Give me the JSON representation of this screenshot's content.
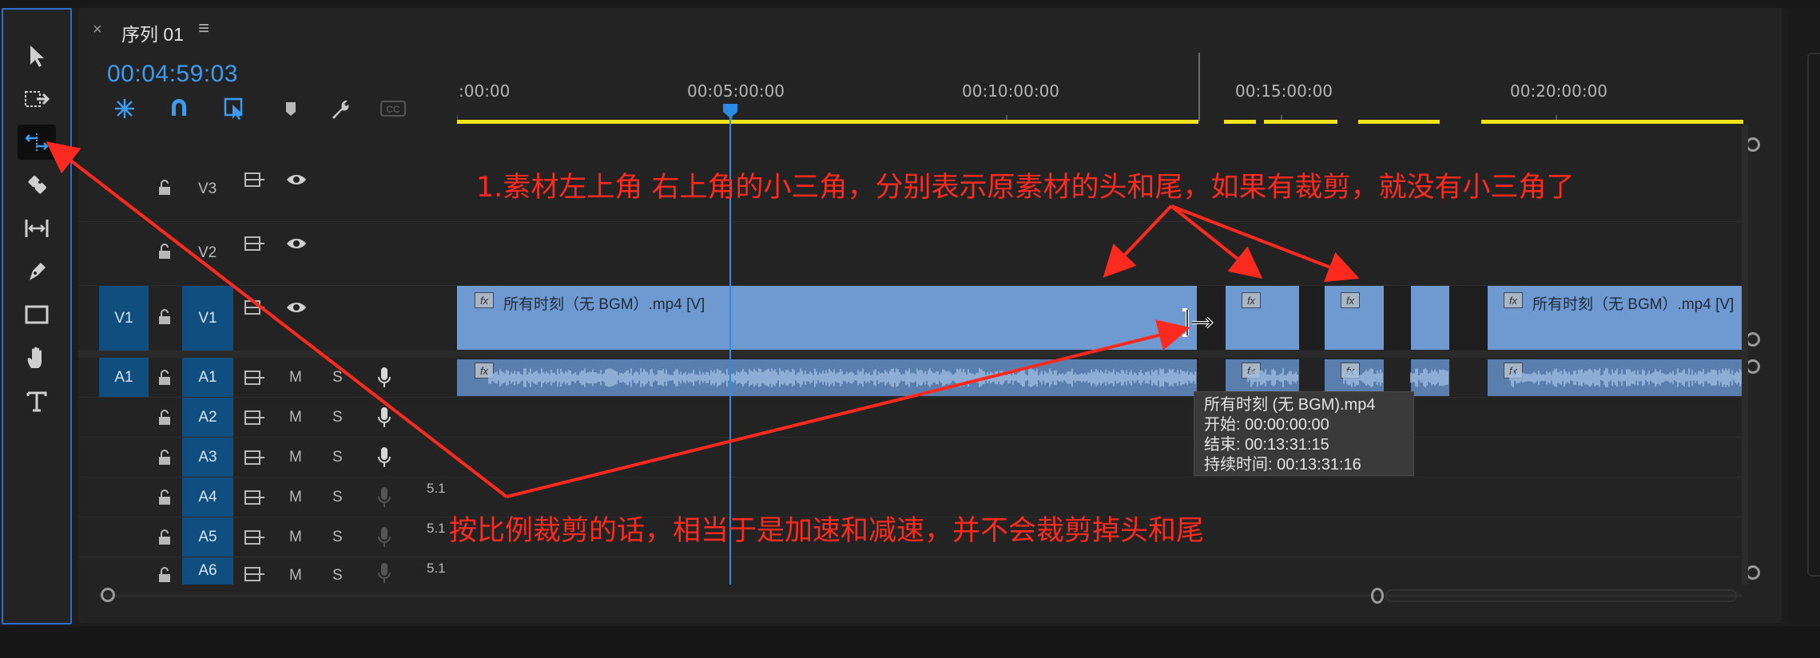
{
  "sequence_tab": {
    "close": "×",
    "title": "序列 01",
    "menu": "≡"
  },
  "timecode": "00:04:59:03",
  "ruler_labels": [
    ":00:00",
    "00:05:00:00",
    "00:10:00:00",
    "00:15:00:00",
    "00:20:00:00"
  ],
  "tracks": {
    "video": [
      {
        "target": "V3",
        "lock": "🔓"
      },
      {
        "target": "V2",
        "lock": "🔓"
      },
      {
        "source": "V1",
        "target": "V1"
      }
    ],
    "audio": [
      {
        "source": "A1",
        "target": "A1",
        "m": "M",
        "s": "S"
      },
      {
        "target": "A2",
        "m": "M",
        "s": "S"
      },
      {
        "target": "A3",
        "m": "M",
        "s": "S"
      },
      {
        "target": "A4",
        "m": "M",
        "s": "S",
        "channels": "5.1"
      },
      {
        "target": "A5",
        "m": "M",
        "s": "S",
        "channels": "5.1"
      },
      {
        "target": "A6",
        "m": "M",
        "s": "S",
        "channels": "5.1"
      }
    ]
  },
  "clips": {
    "v1_clip_1": "所有时刻（无 BGM）.mp4 [V]",
    "v1_clip_last": "所有时刻（无 BGM）.mp4 [V]",
    "fx": "fx"
  },
  "tooltip": {
    "name": "所有时刻 (无 BGM).mp4",
    "start": "开始: 00:00:00:00",
    "end": "结束: 00:13:31:15",
    "duration": "持续时间: 00:13:31:16"
  },
  "annotations": {
    "top": "1.素材左上角 右上角的小三角，分别表示原素材的头和尾，如果有裁剪，就没有小三角了",
    "bottom": "按比例裁剪的话，相当于是加速和减速，并不会裁剪掉头和尾"
  },
  "tools": [
    "selection-tool",
    "track-select-forward-tool",
    "ripple-edit-tool",
    "razor-tool",
    "slip-tool",
    "pen-tool",
    "rectangle-tool",
    "hand-tool",
    "type-tool"
  ],
  "colors": {
    "accent": "#2b8ce8",
    "annotation": "#ff2a1f",
    "clip_video": "#6f9ad1",
    "track_target": "#0f4e7e",
    "work_area": "#f0e21c"
  }
}
